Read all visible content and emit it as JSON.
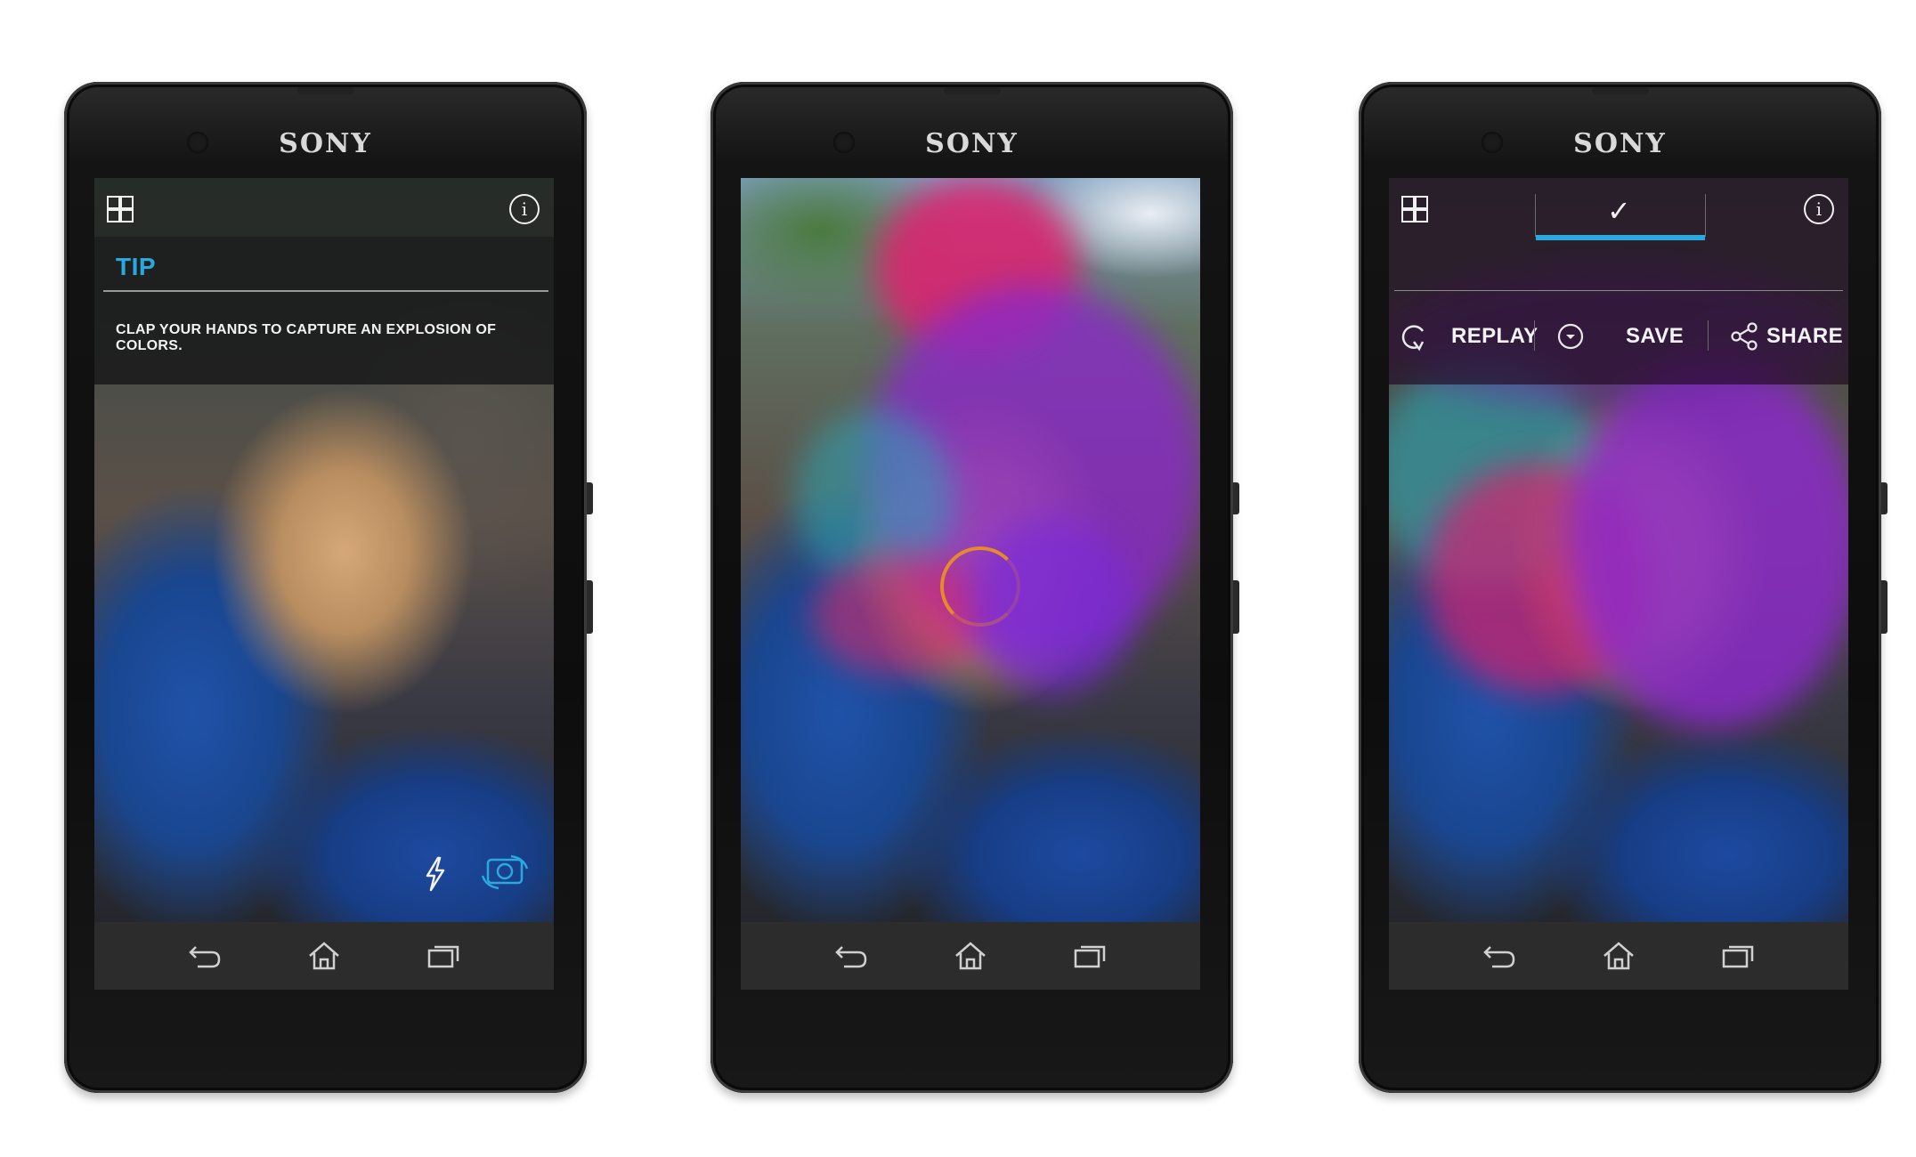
{
  "phones": [
    {
      "brand": "SONY",
      "tip_title": "TIP",
      "tip_text": "CLAP YOUR HANDS TO CAPTURE AN EXPLOSION OF COLORS."
    },
    {
      "brand": "SONY"
    },
    {
      "brand": "SONY",
      "actions": {
        "replay": "REPLAY",
        "save": "SAVE",
        "share": "SHARE"
      }
    }
  ],
  "icons": {
    "grid": "grid-icon",
    "info": "info-icon",
    "flash": "flash-icon",
    "switch_camera": "switch-camera-icon",
    "back": "back-icon",
    "home": "home-icon",
    "recent": "recent-apps-icon",
    "check": "check-icon",
    "replay": "replay-icon",
    "save": "save-icon",
    "share": "share-icon"
  },
  "colors": {
    "accent": "#2aa8e0",
    "loader": "#e48a2a"
  }
}
